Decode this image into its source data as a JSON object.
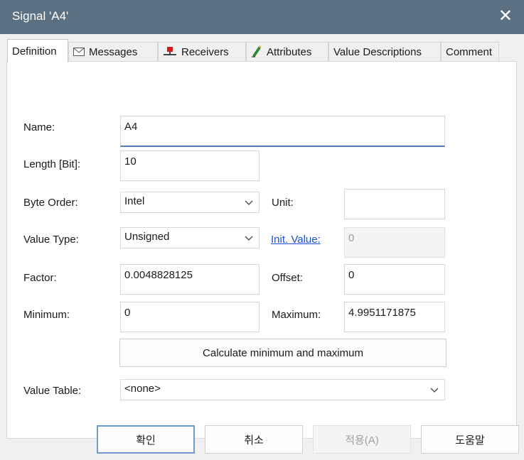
{
  "window": {
    "title": "Signal 'A4'"
  },
  "tabs": [
    {
      "label": "Definition",
      "icon": ""
    },
    {
      "label": "Messages",
      "icon": "envelope-icon"
    },
    {
      "label": "Receivers",
      "icon": "receiver-icon"
    },
    {
      "label": "Attributes",
      "icon": "pen-icon"
    },
    {
      "label": "Value Descriptions",
      "icon": ""
    },
    {
      "label": "Comment",
      "icon": ""
    }
  ],
  "form": {
    "name_label": "Name:",
    "name_value": "A4",
    "length_label": "Length [Bit]:",
    "length_value": "10",
    "byte_order_label": "Byte Order:",
    "byte_order_value": "Intel",
    "unit_label": "Unit:",
    "unit_value": "",
    "value_type_label": "Value Type:",
    "value_type_value": "Unsigned",
    "init_value_label": "Init. Value:",
    "init_value_value": "0",
    "factor_label": "Factor:",
    "factor_value": "0.0048828125",
    "offset_label": "Offset:",
    "offset_value": "0",
    "minimum_label": "Minimum:",
    "minimum_value": "0",
    "maximum_label": "Maximum:",
    "maximum_value": "4.9951171875",
    "calc_button": "Calculate minimum and maximum",
    "value_table_label": "Value Table:",
    "value_table_value": "<none>"
  },
  "buttons": {
    "ok": "확인",
    "cancel": "취소",
    "apply": "적용(A)",
    "help": "도움말"
  },
  "colors": {
    "titlebar": "#5b7080",
    "link": "#1a4fd6",
    "focus_border": "#4f7fb2"
  }
}
